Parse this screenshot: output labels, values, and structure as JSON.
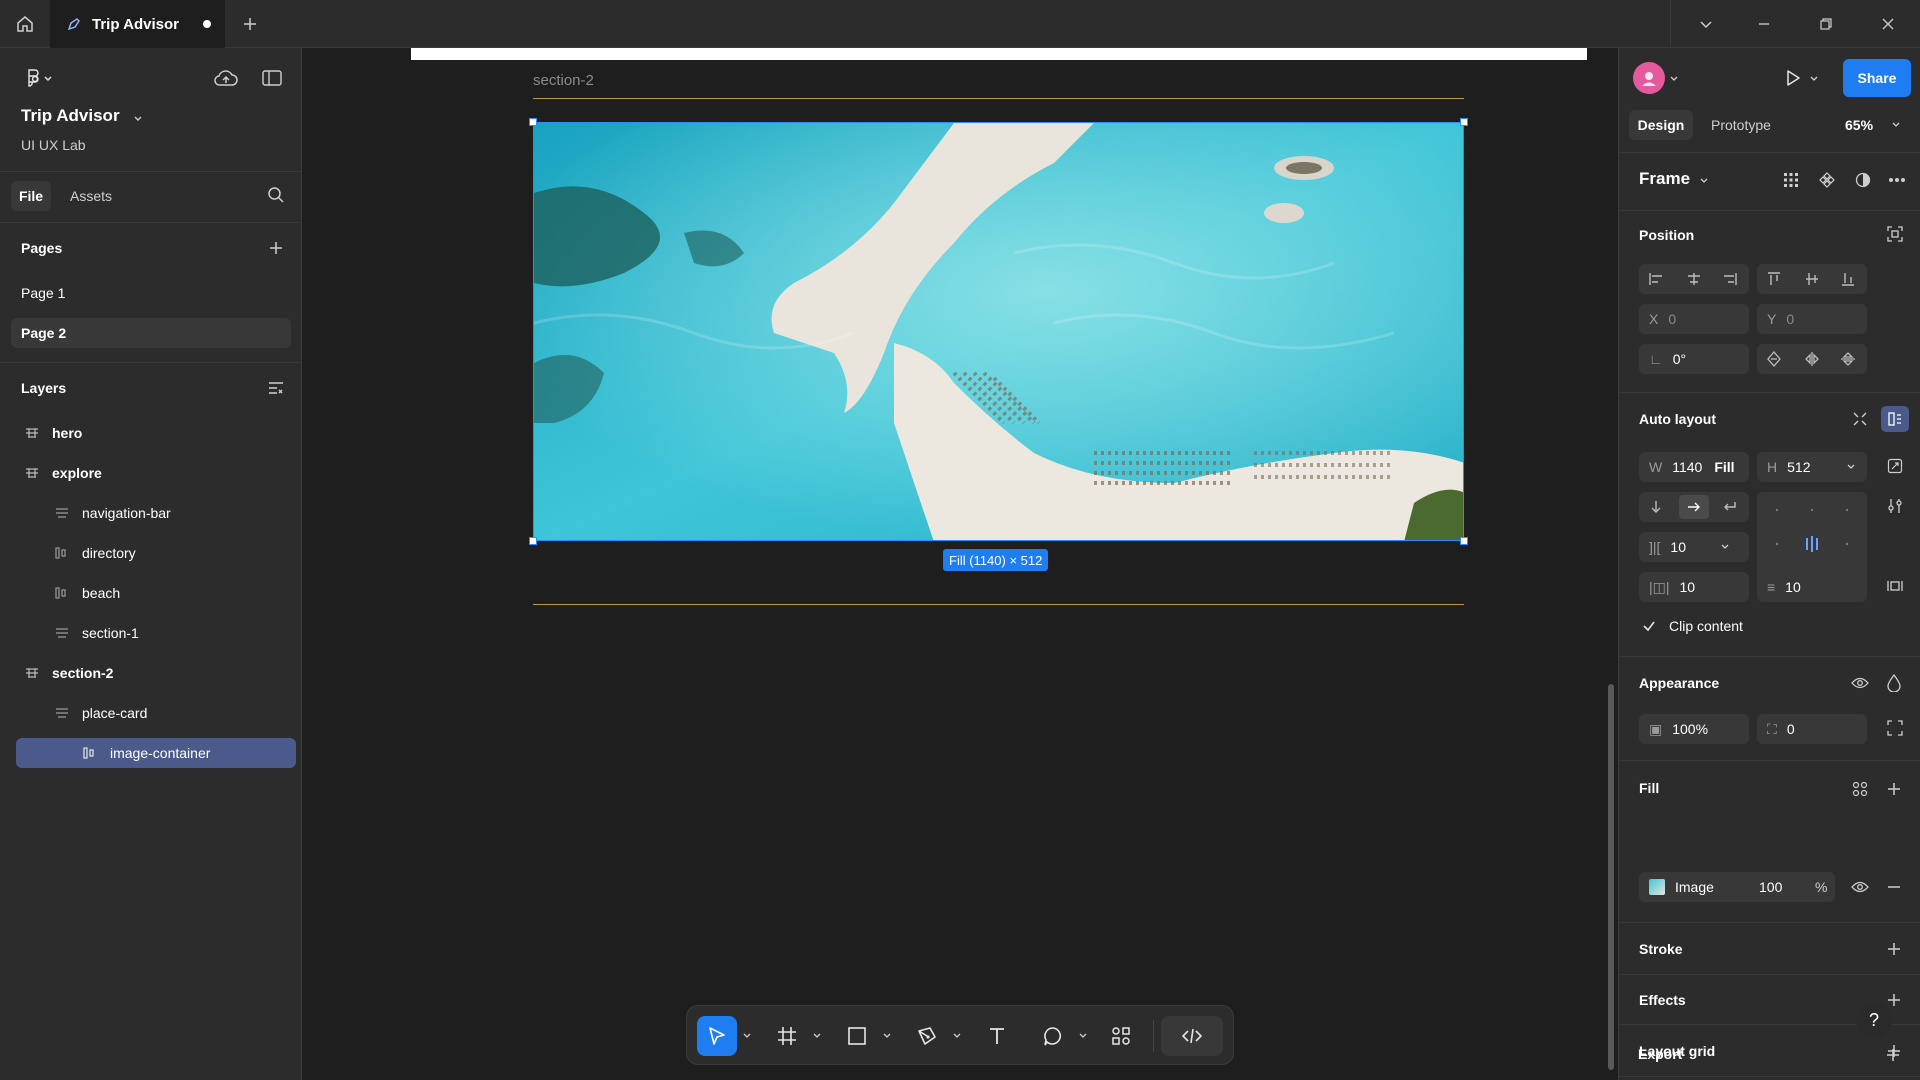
{
  "topbar": {
    "tab_title": "Trip Advisor",
    "icons": [
      "home-icon",
      "file-icon",
      "plus-icon",
      "chevron-down-icon",
      "minimize-icon",
      "restore-icon",
      "close-icon"
    ]
  },
  "left_panel": {
    "project_title": "Trip Advisor",
    "team": "UI UX Lab",
    "tabs": {
      "file": "File",
      "assets": "Assets"
    },
    "pages_heading": "Pages",
    "pages": [
      "Page 1",
      "Page 2"
    ],
    "active_page": "Page 2",
    "layers_heading": "Layers",
    "layers": [
      {
        "name": "hero",
        "icon": "frame-icon"
      },
      {
        "name": "explore",
        "icon": "frame-icon"
      },
      {
        "name": "navigation-bar",
        "icon": "frame-icon"
      },
      {
        "name": "directory",
        "icon": "autolayout-icon"
      },
      {
        "name": "beach",
        "icon": "autolayout-icon"
      },
      {
        "name": "section-1",
        "icon": "frame-icon"
      },
      {
        "name": "section-2",
        "icon": "frame-icon"
      },
      {
        "name": "place-card",
        "icon": "frame-icon"
      },
      {
        "name": "image-container",
        "icon": "autolayout-icon"
      }
    ]
  },
  "canvas": {
    "frame_label": "section-2",
    "selection_badge": "Fill (1140) × 512"
  },
  "right_panel": {
    "share_label": "Share",
    "tabs": {
      "design": "Design",
      "prototype": "Prototype"
    },
    "zoom": "65%",
    "frame_label": "Frame",
    "position": {
      "heading": "Position",
      "x_label": "X",
      "x": "0",
      "y_label": "Y",
      "y": "0",
      "rotation": "0°"
    },
    "auto_layout": {
      "heading": "Auto layout",
      "w_label": "W",
      "w": "1140",
      "w_mode": "Fill",
      "h_label": "H",
      "h": "512",
      "gap": "10",
      "padding_h": "10",
      "padding_v": "10",
      "clip_content": "Clip content",
      "clip_checked": true
    },
    "appearance": {
      "heading": "Appearance",
      "opacity": "100%",
      "radius": "0"
    },
    "fill": {
      "heading": "Fill",
      "type": "Image",
      "opacity": "100",
      "unit": "%"
    },
    "sections": {
      "stroke": "Stroke",
      "effects": "Effects",
      "layout_grid": "Layout grid",
      "export": "Export"
    }
  },
  "help_label": "?",
  "colors": {
    "accent": "#1d7df1",
    "panel": "#2c2c2c",
    "canvas": "#1e1e1e",
    "selection": "#4a5a8a",
    "guide": "#b99a3b"
  }
}
